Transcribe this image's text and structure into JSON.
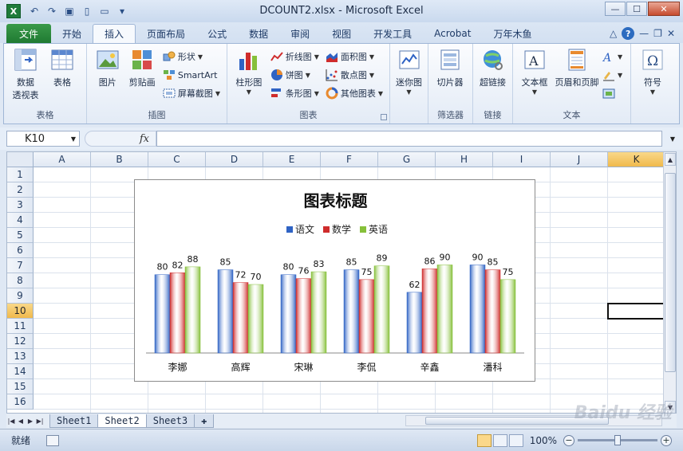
{
  "window": {
    "title": "DCOUNT2.xlsx  -  Microsoft Excel",
    "app_icon": "X",
    "minimize": "—",
    "maximize": "☐",
    "close": "✕"
  },
  "tabs": [
    {
      "label": "文件",
      "kind": "file"
    },
    {
      "label": "开始"
    },
    {
      "label": "插入",
      "active": true
    },
    {
      "label": "页面布局"
    },
    {
      "label": "公式"
    },
    {
      "label": "数据"
    },
    {
      "label": "审阅"
    },
    {
      "label": "视图"
    },
    {
      "label": "开发工具"
    },
    {
      "label": "Acrobat"
    },
    {
      "label": "万年木鱼"
    }
  ],
  "ribbon": {
    "groups": {
      "tables": {
        "label": "表格",
        "pivot": "数据\n透视表",
        "table": "表格"
      },
      "illustrations": {
        "label": "插图",
        "picture": "图片",
        "clipart": "剪贴画",
        "shapes": "形状",
        "smartart": "SmartArt",
        "screenshot": "屏幕截图"
      },
      "charts": {
        "label": "图表",
        "column": "柱形图",
        "line": "折线图",
        "pie": "饼图",
        "bar": "条形图",
        "area": "面积图",
        "scatter": "散点图",
        "other": "其他图表"
      },
      "sparklines": {
        "label": "",
        "sparkline": "迷你图"
      },
      "filter": {
        "label": "筛选器",
        "slicer": "切片器"
      },
      "links": {
        "label": "链接",
        "hyperlink": "超链接"
      },
      "text": {
        "label": "文本",
        "textbox": "文本框",
        "header_footer": "页眉和页脚"
      },
      "symbols": {
        "label": "",
        "symbol": "符号"
      }
    }
  },
  "formula_bar": {
    "name_box": "K10",
    "fx": "fx",
    "value": ""
  },
  "grid": {
    "columns": [
      "A",
      "B",
      "C",
      "D",
      "E",
      "F",
      "G",
      "H",
      "I",
      "J",
      "K"
    ],
    "rows": [
      "1",
      "2",
      "3",
      "4",
      "5",
      "6",
      "7",
      "8",
      "9",
      "10",
      "11",
      "12",
      "13",
      "14",
      "15",
      "16"
    ],
    "selected_column": "K",
    "selected_row": "10"
  },
  "chart_data": {
    "type": "bar",
    "title": "图表标题",
    "categories": [
      "李娜",
      "高辉",
      "宋琳",
      "李侃",
      "辛鑫",
      "潘科"
    ],
    "series": [
      {
        "name": "语文",
        "values": [
          80,
          85,
          80,
          85,
          62,
          90
        ],
        "color": "#2f63c4"
      },
      {
        "name": "数学",
        "values": [
          82,
          72,
          76,
          75,
          86,
          85
        ],
        "color": "#cf2c2c"
      },
      {
        "name": "英语",
        "values": [
          88,
          70,
          83,
          89,
          90,
          75
        ],
        "color": "#86c03a"
      }
    ],
    "legend": "top",
    "ylim": [
      0,
      100
    ],
    "grid": false,
    "data_labels": true
  },
  "sheet_tabs": [
    "Sheet1",
    "Sheet2",
    "Sheet3"
  ],
  "active_sheet": "Sheet2",
  "status": {
    "ready": "就绪",
    "zoom": "100%"
  },
  "watermark": "Baidu 经验"
}
